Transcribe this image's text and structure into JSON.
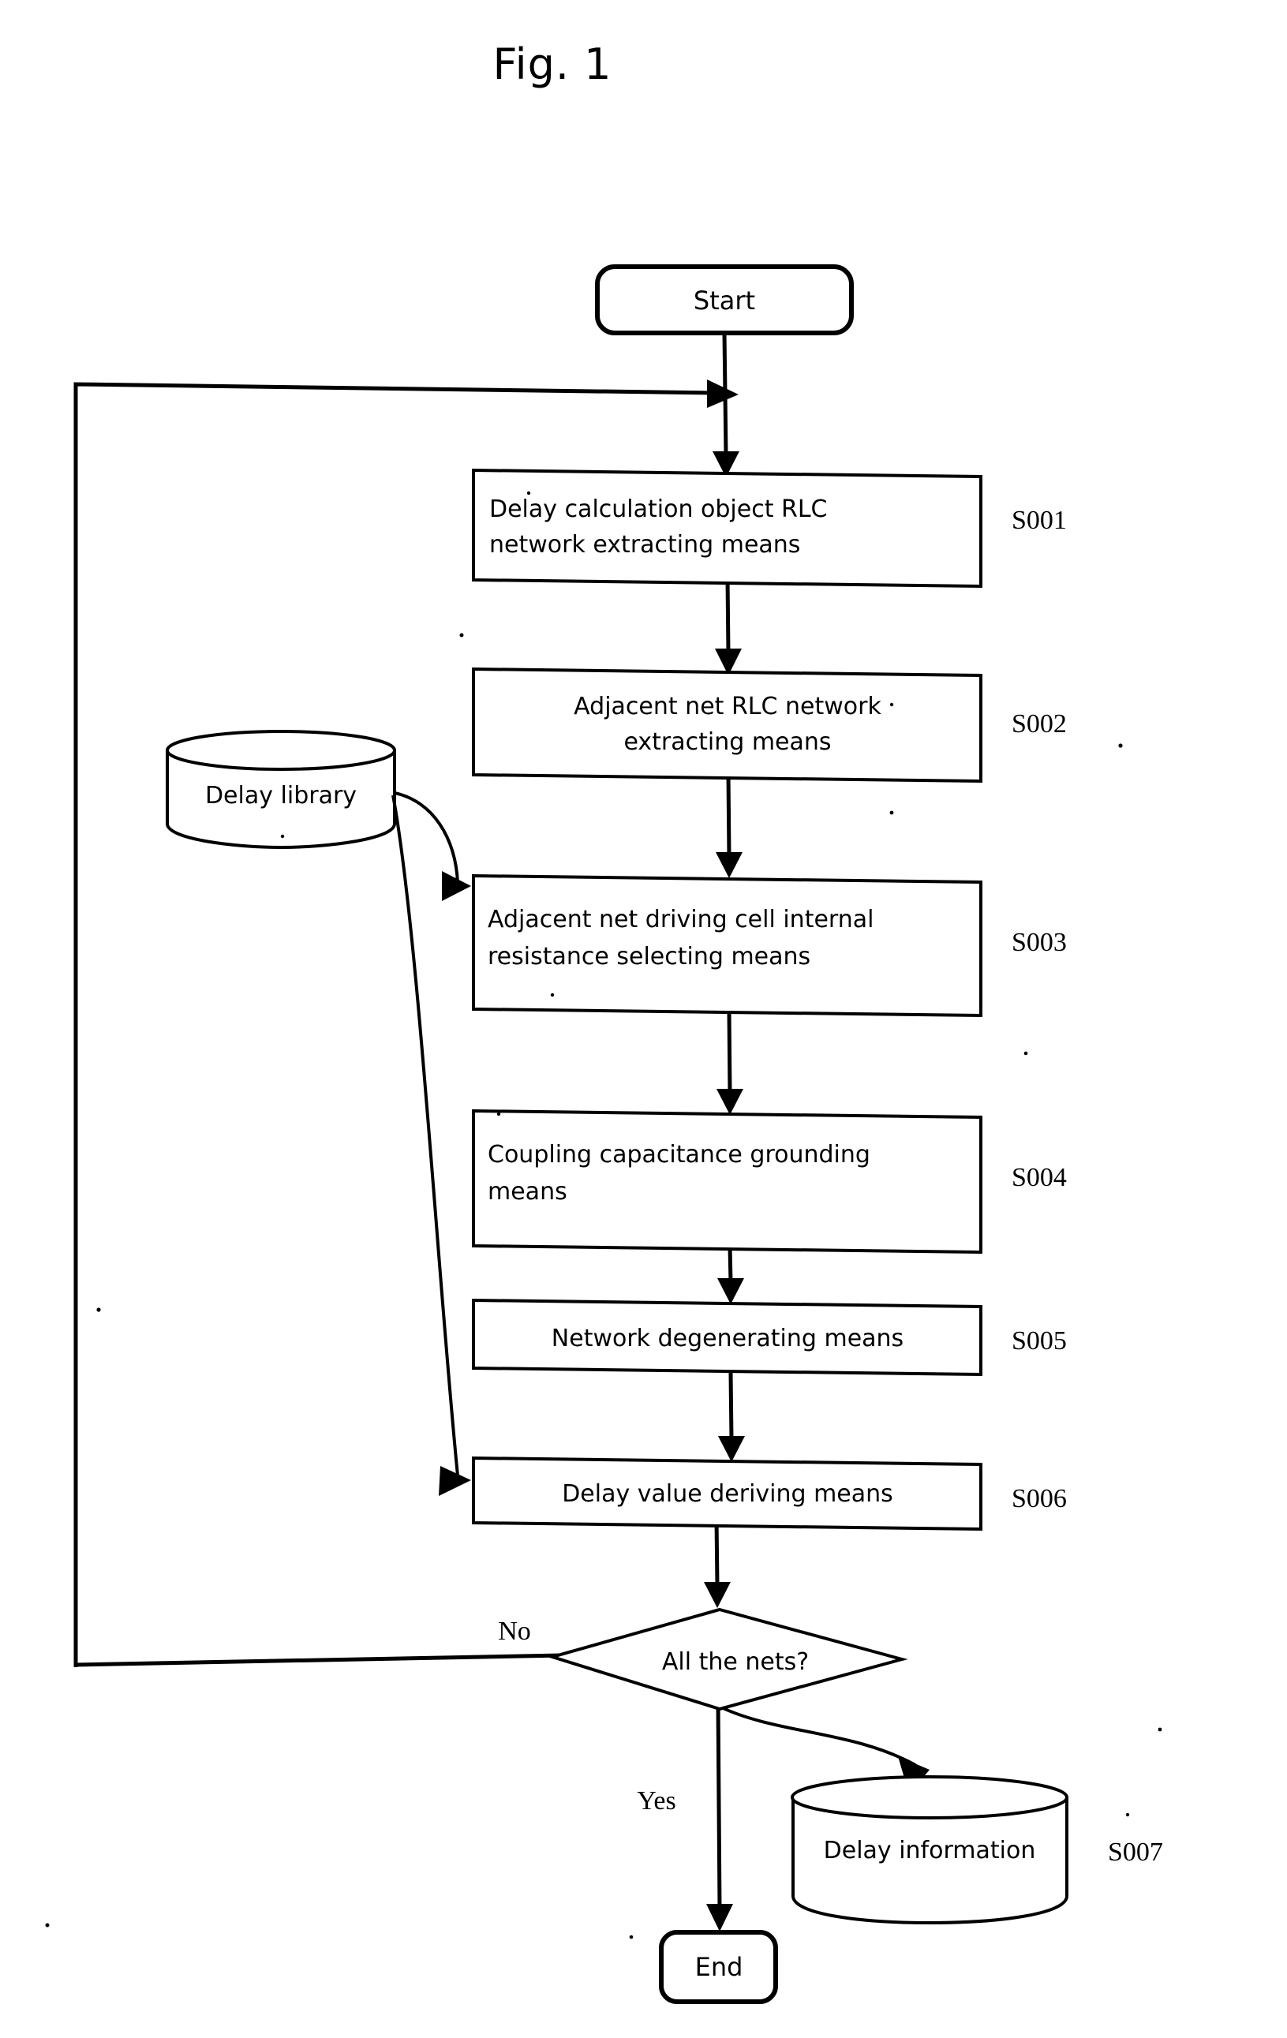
{
  "figure": {
    "title": "Fig. 1",
    "type": "flowchart"
  },
  "nodes": {
    "start": {
      "label": "Start",
      "shape": "terminator"
    },
    "end": {
      "label": "End",
      "shape": "terminator"
    },
    "s001": {
      "step": "S001",
      "line1": "Delay  calculation  object  RLC",
      "line2": "network extracting means",
      "shape": "process"
    },
    "s002": {
      "step": "S002",
      "line1": "Adjacent net RLC network",
      "line2": "extracting means",
      "shape": "process"
    },
    "s003": {
      "step": "S003",
      "line1": "Adjacent net driving cell internal",
      "line2": "resistance selecting means",
      "shape": "process"
    },
    "s004": {
      "step": "S004",
      "line1": "Coupling  capacitance  grounding",
      "line2": "means",
      "shape": "process"
    },
    "s005": {
      "step": "S005",
      "line1": "Network degenerating means",
      "line2": "",
      "shape": "process"
    },
    "s006": {
      "step": "S006",
      "line1": "Delay value deriving means",
      "line2": "",
      "shape": "process"
    },
    "s007": {
      "step": "S007",
      "label": "Delay information",
      "shape": "database"
    },
    "delay_library": {
      "label": "Delay library",
      "shape": "database"
    },
    "decision": {
      "label": "All the nets?",
      "shape": "decision"
    }
  },
  "branches": {
    "no": "No",
    "yes": "Yes"
  },
  "colors": {
    "stroke": "#000000",
    "fill": "#ffffff",
    "background": "#ffffff"
  }
}
